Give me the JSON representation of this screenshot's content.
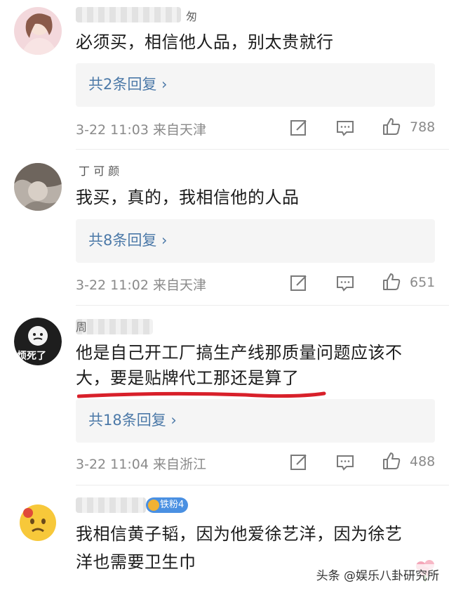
{
  "comments": [
    {
      "username_fragment": "匆",
      "text": "必须买，相信他人品，别太贵就行",
      "replies_label": "共2条回复 ›",
      "meta": "3-22 11:03 来自天津",
      "likes": "788"
    },
    {
      "username_fragment": "丁 可 颜",
      "text": "我买，真的，我相信他的人品",
      "replies_label": "共8条回复 ›",
      "meta": "3-22 11:02 来自天津",
      "likes": "651"
    },
    {
      "username_fragment": "周",
      "avatar_text": "烦死了",
      "text_line1": "他是自己开工厂搞生产线那质量问题应该不",
      "text_line2": "大，要是贴牌代工那还是算了",
      "replies_label": "共18条回复 ›",
      "meta": "3-22 11:04 来自浙江",
      "likes": "488"
    },
    {
      "badge": "铁粉4",
      "text_line1": "我相信黄子韬，因为他爱徐艺洋，因为徐艺",
      "text_line2": "洋也需要卫生巾"
    }
  ],
  "watermark": "头条 @娱乐八卦研究所",
  "colors": {
    "link": "#4c79a8",
    "meta": "#8a8a8a",
    "underline": "#d8202a",
    "badge": "#4a90e2"
  },
  "icons": [
    "edit-icon",
    "comment-icon",
    "thumbs-up-icon"
  ]
}
